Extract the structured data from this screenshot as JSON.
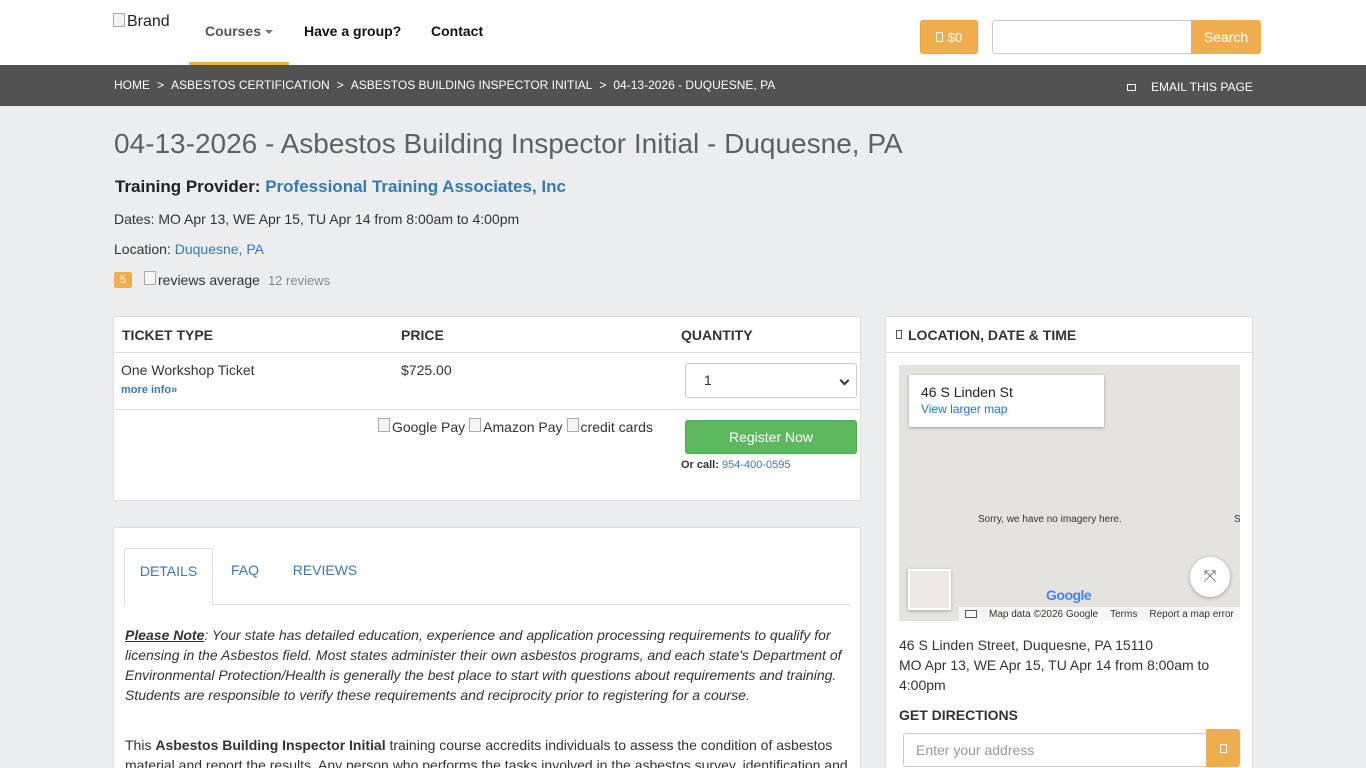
{
  "navbar": {
    "brand_alt": "Brand",
    "courses": "Courses",
    "have_group": "Have a group?",
    "contact": "Contact",
    "cart_amount": "$0",
    "search_placeholder": "",
    "search_button": "Search"
  },
  "breadcrumb": {
    "items": [
      "HOME",
      "ASBESTOS CERTIFICATION",
      "ASBESTOS BUILDING INSPECTOR INITIAL",
      "04-13-2026 - DUQUESNE, PA"
    ],
    "separator": ">",
    "email_page": "EMAIL THIS PAGE"
  },
  "course": {
    "title": "04-13-2026 - Asbestos Building Inspector Initial - Duquesne, PA",
    "provider_label": "Training Provider:",
    "provider_name": "Professional Training Associates, Inc",
    "dates": "Dates: MO Apr 13, WE Apr 15, TU Apr 14 from 8:00am to 4:00pm",
    "location_label": "Location:",
    "location_link": "Duquesne, PA",
    "rating": "5",
    "reviews_alt": "reviews average",
    "reviews_count": "12 reviews"
  },
  "ticket": {
    "head_type": "TICKET TYPE",
    "head_price": "PRICE",
    "head_quantity": "QUANTITY",
    "name": "One Workshop Ticket",
    "more_info": "more info»",
    "price": "$725.00",
    "quantity": "1",
    "pay_google": "Google Pay",
    "pay_amazon": "Amazon Pay",
    "pay_cards": "credit cards",
    "register": "Register Now",
    "or_call": "Or call:",
    "phone": "954-400-0595"
  },
  "details": {
    "tabs": [
      "DETAILS",
      "FAQ",
      "REVIEWS"
    ],
    "note_label": "Please Note",
    "note_text": ": Your state has detailed education, experience and application processing requirements to qualify for licensing in the Asbestos field. Most states administer their own asbestos programs, and each state's Department of Environmental Protection/Health is generally the best place to start with questions about requirements and training. Students are responsible to verify these requirements and reciprocity prior to registering for a course.",
    "desc_prefix": "This ",
    "desc_bold": "Asbestos Building Inspector Initial",
    "desc_rest": " training course accredits individuals to assess the condition of asbestos material and report the results. Any person who performs the tasks involved in the asbestos survey, identification and"
  },
  "sidebar": {
    "heading": "LOCATION, DATE & TIME",
    "map_address": "46 S Linden St",
    "map_larger": "View larger map",
    "map_sorry": "Sorry, we have no imagery here.",
    "map_s": "S",
    "google_logo": "Google",
    "map_data": "Map data ©2026 Google",
    "map_terms": "Terms",
    "map_report": "Report a map error",
    "full_address": "46 S Linden Street, Duquesne, PA 15110",
    "schedule": "MO Apr 13, WE Apr 15, TU Apr 14 from 8:00am to 4:00pm",
    "get_directions": "GET DIRECTIONS",
    "address_placeholder": "Enter your address"
  },
  "colors": {
    "accent": "#f0ad4e",
    "link": "#337ab7",
    "success": "#5cb85c",
    "breadcrumb_bg": "#525252"
  }
}
